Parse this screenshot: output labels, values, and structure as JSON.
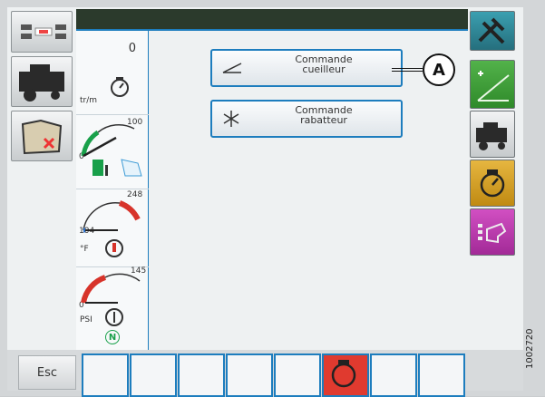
{
  "status": {
    "engine_speed_value": "0",
    "engine_speed_unit": "tr/m"
  },
  "fuel_gauge": {
    "max": "100",
    "min": "0"
  },
  "temp_gauge": {
    "max": "248",
    "current": "104",
    "unit": "°F"
  },
  "oil_gauge": {
    "max": "145",
    "min": "0",
    "unit": "PSI"
  },
  "gear": {
    "indicator": "N"
  },
  "menu": {
    "items": [
      {
        "label": "Commande\ncueilleur",
        "icon": "header-ramp-icon"
      },
      {
        "label": "Commande\nrabatteur",
        "icon": "reel-icon"
      }
    ]
  },
  "callout": {
    "label": "A"
  },
  "bottom": {
    "esc_label": "Esc"
  },
  "figure_id": "1002720",
  "colors": {
    "accent": "#1d7dbe",
    "active_slot": "#e03a2f",
    "topbar": "#2b3a2c"
  }
}
